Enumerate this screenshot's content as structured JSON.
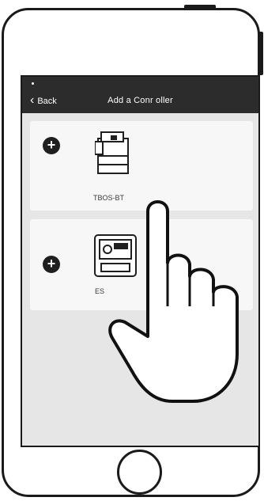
{
  "header": {
    "status_dot": "•",
    "back_label": "Back",
    "title": "Add a Conr oller"
  },
  "devices": [
    {
      "name": "TBOS-BT",
      "add_symbol": "+"
    },
    {
      "name": "ES",
      "add_symbol": "+"
    }
  ],
  "icons": {
    "back": "chevron-left-icon",
    "add": "plus-circle-icon",
    "controller1": "tbos-bt-controller-icon",
    "controller2": "esp-controller-icon",
    "pointer": "pointing-hand-icon"
  },
  "colors": {
    "header_bg": "#2c2c2c",
    "screen_bg": "#e6e6e6",
    "card_bg": "#f7f7f7",
    "icon_dark": "#1f1f1f"
  }
}
